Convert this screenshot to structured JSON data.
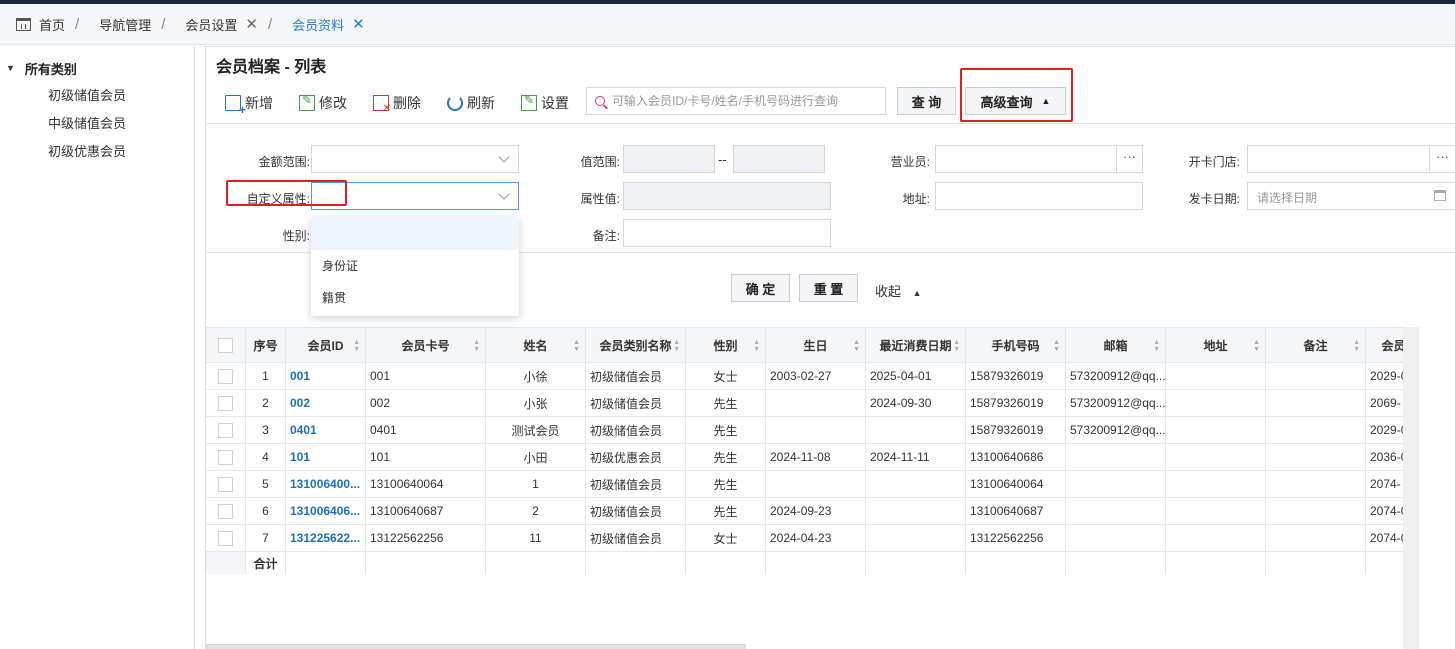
{
  "tabs": [
    {
      "label": "首页",
      "sep": "/"
    },
    {
      "label": "导航管理",
      "sep": "/"
    },
    {
      "label": "会员设置",
      "close": "✕",
      "sep": "/"
    },
    {
      "label": "会员资料",
      "close": "✕"
    }
  ],
  "sidebar": {
    "root": "所有类别",
    "items": [
      "初级储值会员",
      "中级储值会员",
      "初级优惠会员"
    ]
  },
  "panel": {
    "title": "会员档案 - 列表"
  },
  "toolbar": {
    "add": "新增",
    "edit": "修改",
    "delete": "删除",
    "refresh": "刷新",
    "settings": "设置",
    "search_placeholder": "可输入会员ID/卡号/姓名/手机号码进行查询",
    "query": "查 询",
    "advanced": "高级查询"
  },
  "filter": {
    "amount_range": "金额范围:",
    "value_range": "值范围:",
    "range_dash": "--",
    "salesperson": "营业员:",
    "store": "开卡门店:",
    "custom_attr": "自定义属性:",
    "attr_value": "属性值:",
    "address": "地址:",
    "issue_date": "发卡日期:",
    "issue_date_placeholder": "请选择日期",
    "gender": "性别:",
    "remark": "备注:",
    "lookup": "···"
  },
  "dropdown": {
    "options": [
      "",
      "身份证",
      "籍贯"
    ]
  },
  "actions": {
    "confirm": "确 定",
    "reset": "重 置",
    "collapse": "收起"
  },
  "table": {
    "headers": [
      "序号",
      "会员ID",
      "会员卡号",
      "姓名",
      "会员类别名称",
      "性别",
      "生日",
      "最近消费日期",
      "手机号码",
      "邮箱",
      "地址",
      "备注",
      "会员有效"
    ],
    "rows": [
      [
        "1",
        "001",
        "001",
        "小徐",
        "初级储值会员",
        "女士",
        "2003-02-27",
        "2025-04-01",
        "15879326019",
        "573200912@qq...",
        "",
        "",
        "2029-0"
      ],
      [
        "2",
        "002",
        "002",
        "小张",
        "初级储值会员",
        "先生",
        "",
        "2024-09-30",
        "15879326019",
        "573200912@qq...",
        "",
        "",
        "2069-"
      ],
      [
        "3",
        "0401",
        "0401",
        "测试会员",
        "初级储值会员",
        "先生",
        "",
        "",
        "15879326019",
        "573200912@qq...",
        "",
        "",
        "2029-0"
      ],
      [
        "4",
        "101",
        "101",
        "小田",
        "初级优惠会员",
        "先生",
        "2024-11-08",
        "2024-11-11",
        "13100640686",
        "",
        "",
        "",
        "2036-0"
      ],
      [
        "5",
        "131006400...",
        "13100640064",
        "1",
        "初级储值会员",
        "先生",
        "",
        "",
        "13100640064",
        "",
        "",
        "",
        "2074-"
      ],
      [
        "6",
        "131006406...",
        "13100640687",
        "2",
        "初级储值会员",
        "先生",
        "2024-09-23",
        "",
        "13100640687",
        "",
        "",
        "",
        "2074-0"
      ],
      [
        "7",
        "131225622...",
        "13122562256",
        "11",
        "初级储值会员",
        "女士",
        "2024-04-23",
        "",
        "13122562256",
        "",
        "",
        "",
        "2074-0"
      ]
    ],
    "sum_label": "合计"
  }
}
